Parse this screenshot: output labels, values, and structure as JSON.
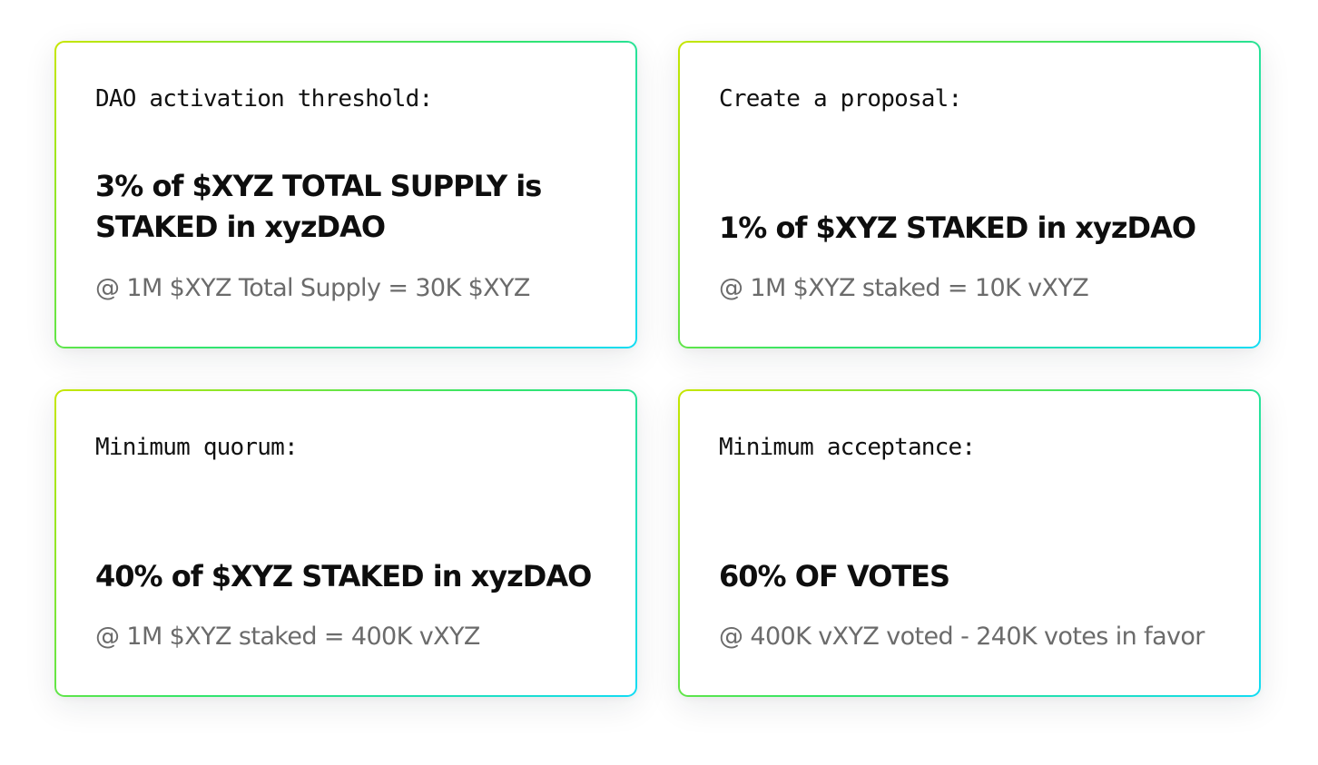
{
  "cards": [
    {
      "label": "DAO activation threshold:",
      "value": "3% of $XYZ TOTAL SUPPLY is STAKED in xyzDAO",
      "note": "@ 1M $XYZ Total Supply = 30K $XYZ"
    },
    {
      "label": "Create a proposal:",
      "value": "1% of $XYZ STAKED in xyzDAO",
      "note": "@ 1M $XYZ staked = 10K vXYZ"
    },
    {
      "label": "Minimum quorum:",
      "value": "40% of $XYZ STAKED in xyzDAO",
      "note": "@ 1M $XYZ staked = 400K vXYZ"
    },
    {
      "label": "Minimum acceptance:",
      "value": "60% OF VOTES",
      "note": "@ 400K vXYZ voted - 240K votes in favor"
    }
  ],
  "colors": {
    "border_gradient": [
      "#c7e600",
      "#33e56a",
      "#12dcf4"
    ],
    "label": "#111111",
    "value": "#0e0e0e",
    "note": "#6b6b6b"
  }
}
